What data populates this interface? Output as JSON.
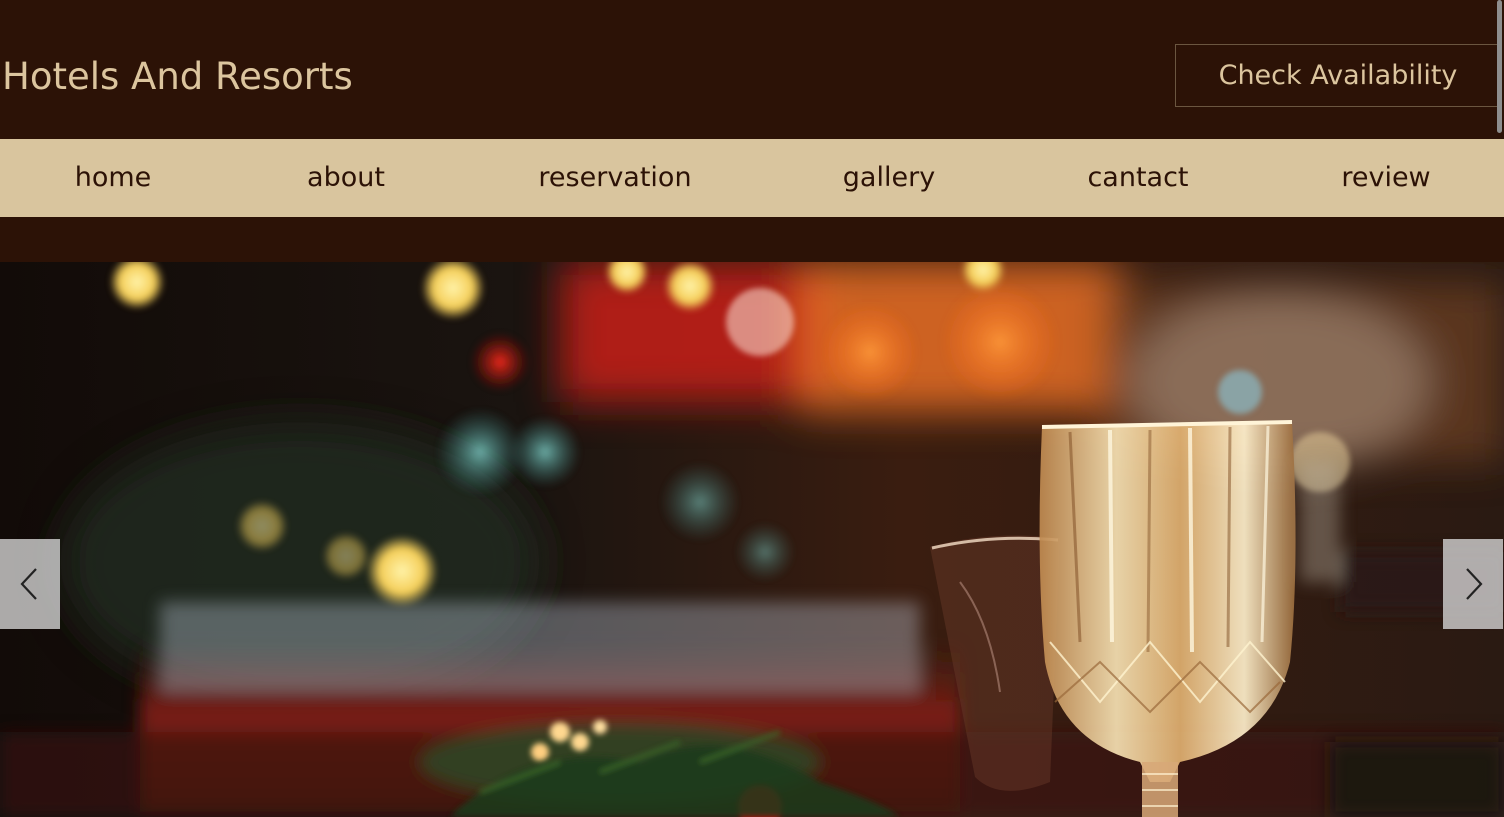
{
  "header": {
    "brand": "Hotels And Resorts",
    "check_availability": "Check Availability"
  },
  "nav": {
    "items": [
      {
        "label": "home"
      },
      {
        "label": "about"
      },
      {
        "label": "reservation"
      },
      {
        "label": "gallery"
      },
      {
        "label": "cantact"
      },
      {
        "label": "review"
      }
    ]
  },
  "slider": {
    "prev_icon": "chevron-left-icon",
    "next_icon": "chevron-right-icon"
  },
  "colors": {
    "background": "#2c1206",
    "nav_background": "#d9c59e",
    "brand_text": "#dcc59e",
    "nav_text": "#2c1206"
  }
}
